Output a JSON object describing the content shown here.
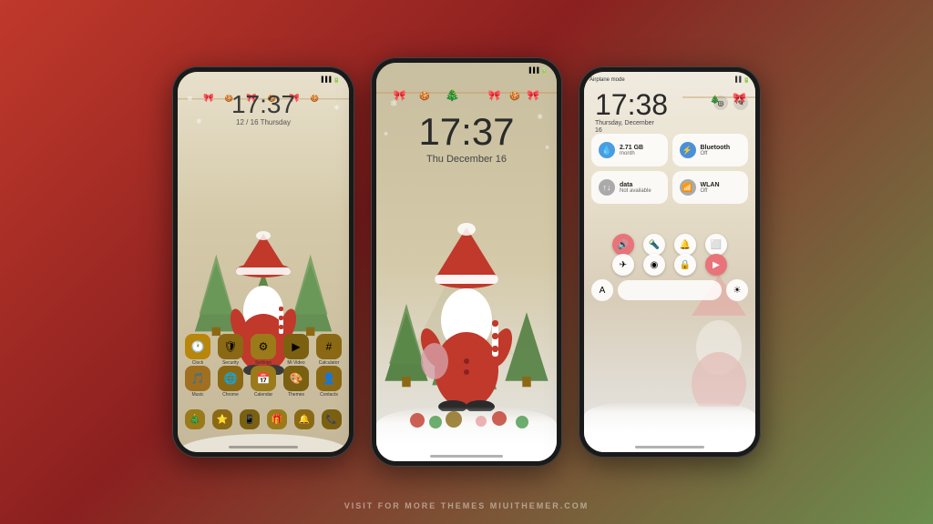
{
  "phones": [
    {
      "id": "phone1",
      "type": "homescreen",
      "status": {
        "time": "17:37",
        "date": "12 / 16  Thursday"
      },
      "apps_row1": [
        {
          "label": "Clock",
          "emoji": "🕐"
        },
        {
          "label": "Security",
          "emoji": "🛡"
        },
        {
          "label": "Settings",
          "emoji": "⚙"
        },
        {
          "label": "Mi Video",
          "emoji": "▶"
        },
        {
          "label": "Calculator",
          "emoji": "🔢"
        }
      ],
      "apps_row2": [
        {
          "label": "Music",
          "emoji": "🎵"
        },
        {
          "label": "Chrome",
          "emoji": "🌐"
        },
        {
          "label": "Calendar",
          "emoji": "📅"
        },
        {
          "label": "Themes",
          "emoji": "🎨"
        },
        {
          "label": "Contacts",
          "emoji": "👤"
        }
      ]
    },
    {
      "id": "phone2",
      "type": "lockscreen",
      "status": {
        "time": "17:37",
        "date": "Thu December 16"
      }
    },
    {
      "id": "phone3",
      "type": "quicksettings",
      "status": {
        "airplane_mode": "Airplane mode",
        "time": "17:38",
        "date": "Thursday, December",
        "date2": "16"
      },
      "tiles": [
        {
          "title": "2.71 GB",
          "sub": "month",
          "icon": "💧",
          "type": "water"
        },
        {
          "title": "Bluetooth",
          "sub": "Off",
          "icon": "🔵",
          "type": "bluetooth"
        },
        {
          "title": "data",
          "sub": "Not available",
          "icon": "📶",
          "type": "data"
        },
        {
          "title": "WLAN",
          "sub": "Off",
          "icon": "📶",
          "type": "wifi"
        }
      ],
      "controls": [
        [
          {
            "icon": "🔊",
            "active": true
          },
          {
            "icon": "🔦",
            "active": false
          },
          {
            "icon": "🔔",
            "active": false
          },
          {
            "icon": "⬜",
            "active": false
          }
        ],
        [
          {
            "icon": "✈",
            "active": false
          },
          {
            "icon": "⊙",
            "active": false
          },
          {
            "icon": "🔒",
            "active": false
          },
          {
            "icon": "▶",
            "active": true
          }
        ]
      ]
    }
  ],
  "watermark": "VISIT FOR MORE THEMES MIUITHEMER.COM"
}
